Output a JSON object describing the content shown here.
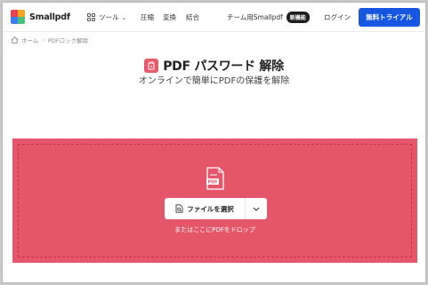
{
  "header": {
    "logo_text": "Smallpdf",
    "tools_label": "ツール",
    "nav": [
      "圧縮",
      "変換",
      "結合"
    ],
    "team_label": "チーム用Smallpdf",
    "team_badge": "新機能",
    "login_label": "ログイン",
    "trial_label": "無料トライアル"
  },
  "breadcrumb": {
    "home": "ホーム",
    "current": "PDFロック解除"
  },
  "hero": {
    "title": "PDF パスワード 解除",
    "subtitle": "オンラインで簡単にPDFの保護を解除"
  },
  "dropzone": {
    "file_icon_label": "PDF",
    "choose_label": "ファイルを選択",
    "drop_text": "またはここにPDFをドロップ"
  },
  "colors": {
    "accent": "#1756e0",
    "dropzone": "#e5566a",
    "tool_icon": "#e85a6a"
  }
}
